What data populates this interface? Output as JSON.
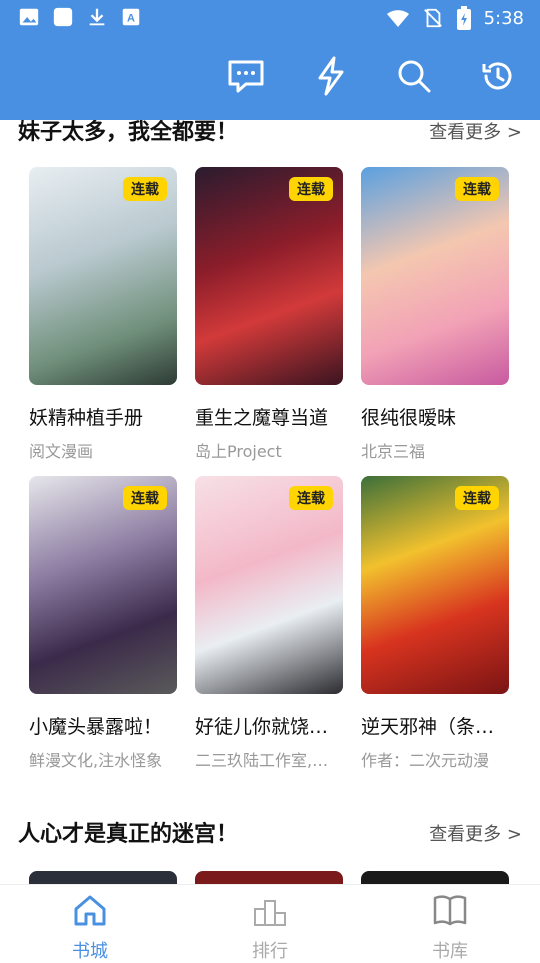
{
  "status_bar": {
    "time": "5:38",
    "left_icons": [
      "image-icon",
      "square-icon",
      "download-icon",
      "font-icon"
    ],
    "right_icons": [
      "wifi-icon",
      "no-sim-icon",
      "battery-icon"
    ]
  },
  "appbar": {
    "icons": [
      "chat-icon",
      "lightning-icon",
      "search-icon",
      "history-icon"
    ],
    "accent": "#4a90e2"
  },
  "sections": [
    {
      "title": "妹子太多，我全都要！",
      "more": "查看更多 >",
      "books": [
        {
          "title": "妖精种植手册",
          "author": "阅文漫画",
          "badge": "连载"
        },
        {
          "title": "重生之魔尊当道",
          "author": "岛上Project",
          "badge": "连载"
        },
        {
          "title": "很纯很暧昧",
          "author": "北京三福",
          "badge": "连载"
        },
        {
          "title": "小魔头暴露啦！",
          "author": "鲜漫文化,注水怪象",
          "badge": "连载"
        },
        {
          "title": "好徒儿你就饶…",
          "author": "二三玖陆工作室,…",
          "badge": "连载"
        },
        {
          "title": "逆天邪神（条…",
          "author": "作者：二次元动漫",
          "badge": "连载"
        }
      ]
    },
    {
      "title": "人心才是真正的迷宫！",
      "more": "查看更多 >"
    }
  ],
  "bottom_nav": [
    {
      "label": "书城",
      "icon": "home-icon",
      "active": true
    },
    {
      "label": "排行",
      "icon": "podium-icon",
      "active": false
    },
    {
      "label": "书库",
      "icon": "book-icon",
      "active": false
    }
  ]
}
